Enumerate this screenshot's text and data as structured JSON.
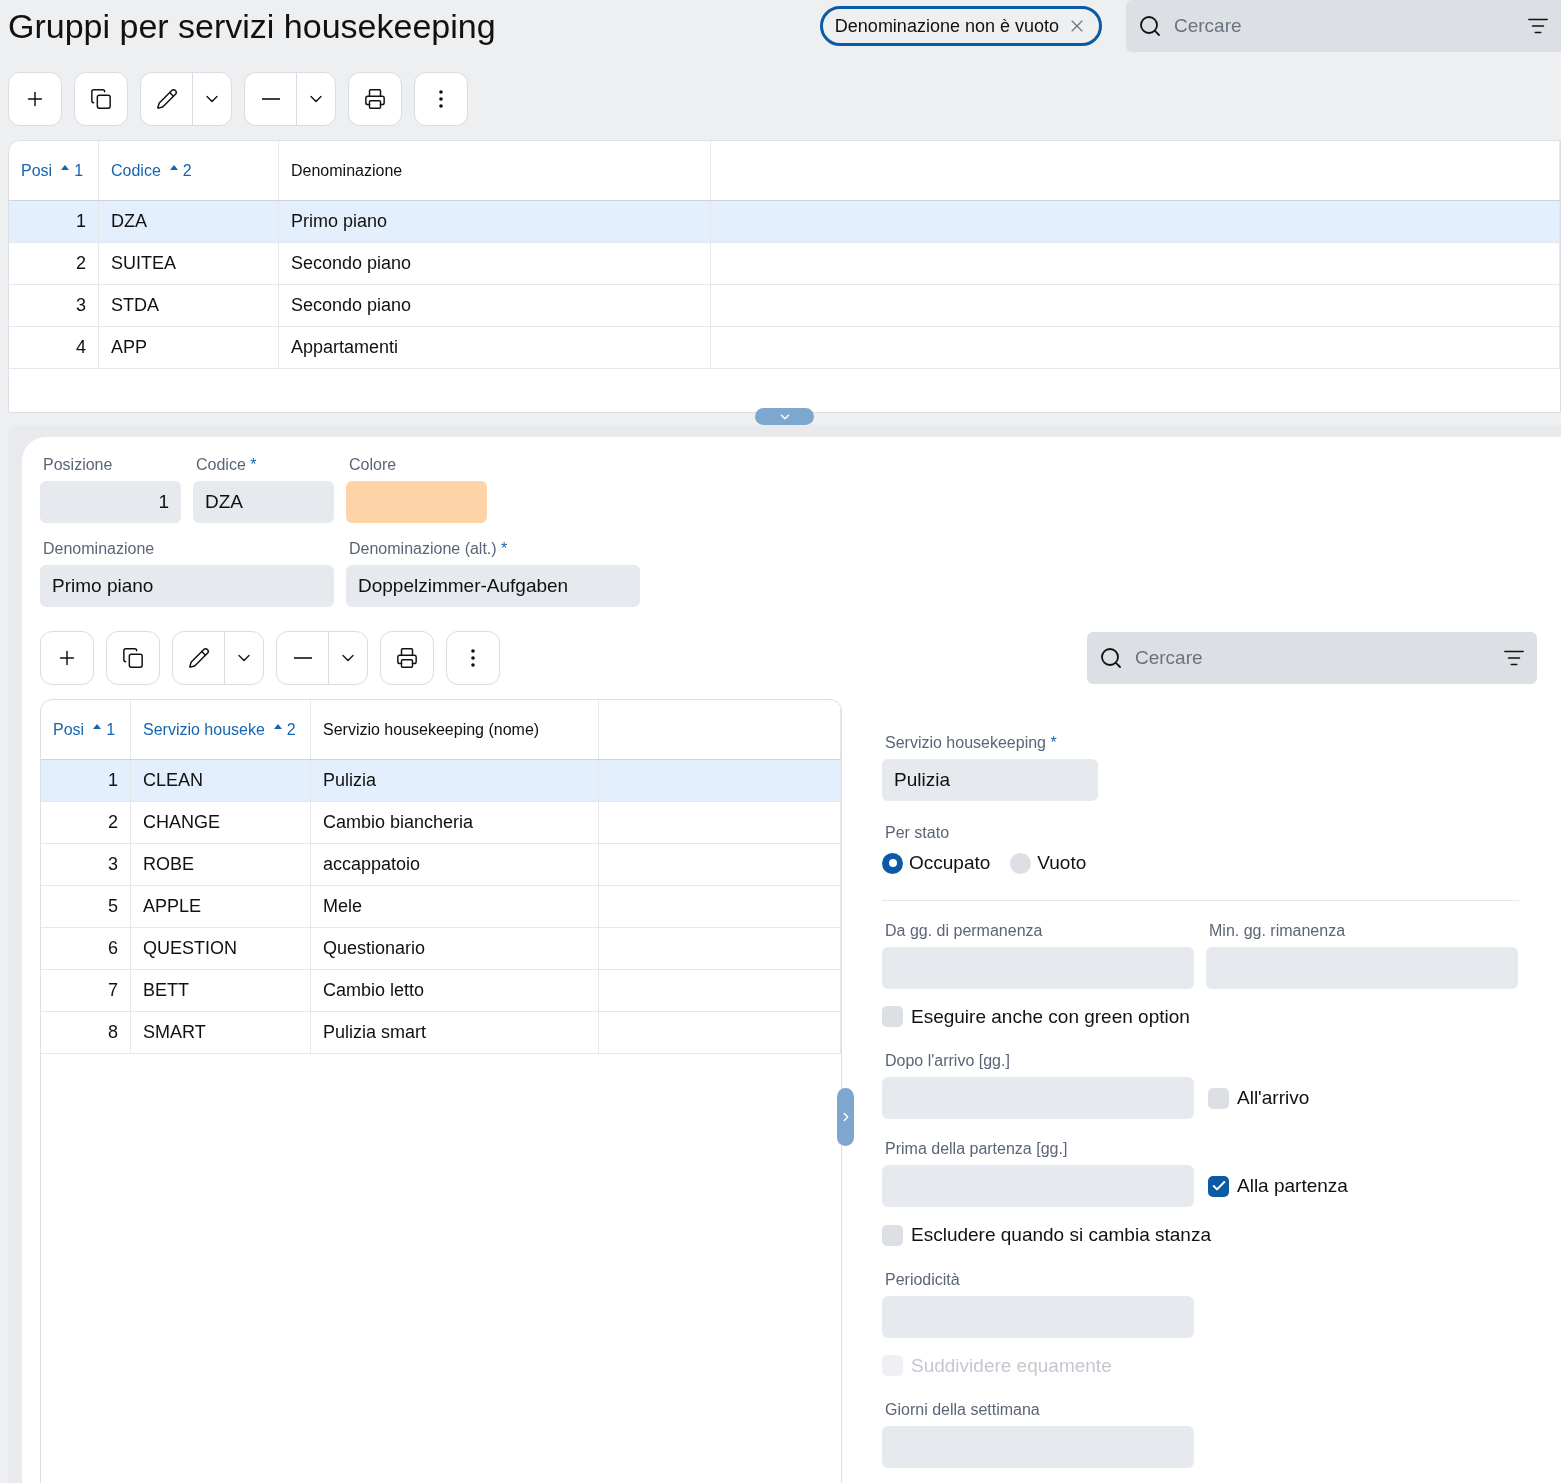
{
  "title": "Gruppi per servizi housekeeping",
  "filter_chip": {
    "label": "Denominazione non è vuoto"
  },
  "search": {
    "placeholder": "Cercare"
  },
  "table": {
    "columns": [
      {
        "label": "Posi",
        "sort_rank": "1"
      },
      {
        "label": "Codice",
        "sort_rank": "2"
      },
      {
        "label": "Denominazione"
      }
    ],
    "rows": [
      {
        "cells": [
          "1",
          "DZA",
          "Primo piano"
        ],
        "selected": true
      },
      {
        "cells": [
          "2",
          "SUITEA",
          "Secondo piano"
        ],
        "selected": false
      },
      {
        "cells": [
          "3",
          "STDA",
          "Secondo piano"
        ],
        "selected": false
      },
      {
        "cells": [
          "4",
          "APP",
          "Appartamenti"
        ],
        "selected": false
      }
    ]
  },
  "detail": {
    "fields": [
      {
        "kind": "input",
        "label": "Posizione",
        "value": "1"
      },
      {
        "kind": "input",
        "label": "Codice",
        "required_mark": "*",
        "value": "DZA"
      },
      {
        "kind": "color",
        "label": "Colore",
        "color": "#fed3a8"
      },
      {
        "kind": "input",
        "label": "Denominazione",
        "value": "Primo piano"
      },
      {
        "kind": "input",
        "label": "Denominazione (alt.)",
        "required_mark": "*",
        "value": "Doppelzimmer-Aufgaben"
      }
    ],
    "search": {
      "placeholder": "Cercare"
    },
    "table": {
      "columns": [
        {
          "label": "Posi",
          "sort_rank": "1"
        },
        {
          "label": "Servizio houseke",
          "sort_rank": "2"
        },
        {
          "label": "Servizio housekeeping (nome)"
        }
      ],
      "rows": [
        {
          "cells": [
            "1",
            "CLEAN",
            "Pulizia"
          ],
          "selected": true
        },
        {
          "cells": [
            "2",
            "CHANGE",
            "Cambio biancheria"
          ],
          "selected": false
        },
        {
          "cells": [
            "3",
            "ROBE",
            "accappatoio"
          ],
          "selected": false
        },
        {
          "cells": [
            "5",
            "APPLE",
            "Mele"
          ],
          "selected": false
        },
        {
          "cells": [
            "6",
            "QUESTION",
            "Questionario"
          ],
          "selected": false
        },
        {
          "cells": [
            "7",
            "BETT",
            "Cambio letto"
          ],
          "selected": false
        },
        {
          "cells": [
            "8",
            "SMART",
            "Pulizia smart"
          ],
          "selected": false
        }
      ]
    }
  },
  "service_form": {
    "service": {
      "label": "Servizio housekeeping",
      "required_mark": "*",
      "value": "Pulizia"
    },
    "status": {
      "label": "Per stato",
      "options": [
        {
          "label": "Occupato",
          "selected": true
        },
        {
          "label": "Vuoto",
          "selected": false
        }
      ]
    },
    "stay_fields": [
      {
        "label": "Da gg. di permanenza"
      },
      {
        "label": "Min. gg. rimanenza"
      }
    ],
    "green_option": {
      "label": "Eseguire anche con green option",
      "checked": false
    },
    "after_arrival": {
      "label": "Dopo l'arrivo [gg.]",
      "checkbox": {
        "label": "All'arrivo",
        "checked": false
      }
    },
    "before_departure": {
      "label": "Prima della partenza [gg.]",
      "checkbox": {
        "label": "Alla partenza",
        "checked": true
      }
    },
    "exclude_room_change": {
      "label": "Escludere quando si cambia stanza",
      "checked": false
    },
    "periodicity": {
      "label": "Periodicità"
    },
    "divide_evenly": {
      "label": "Suddividere equamente",
      "checked": false,
      "disabled": true
    },
    "weekdays": {
      "label": "Giorni della settimana"
    }
  }
}
